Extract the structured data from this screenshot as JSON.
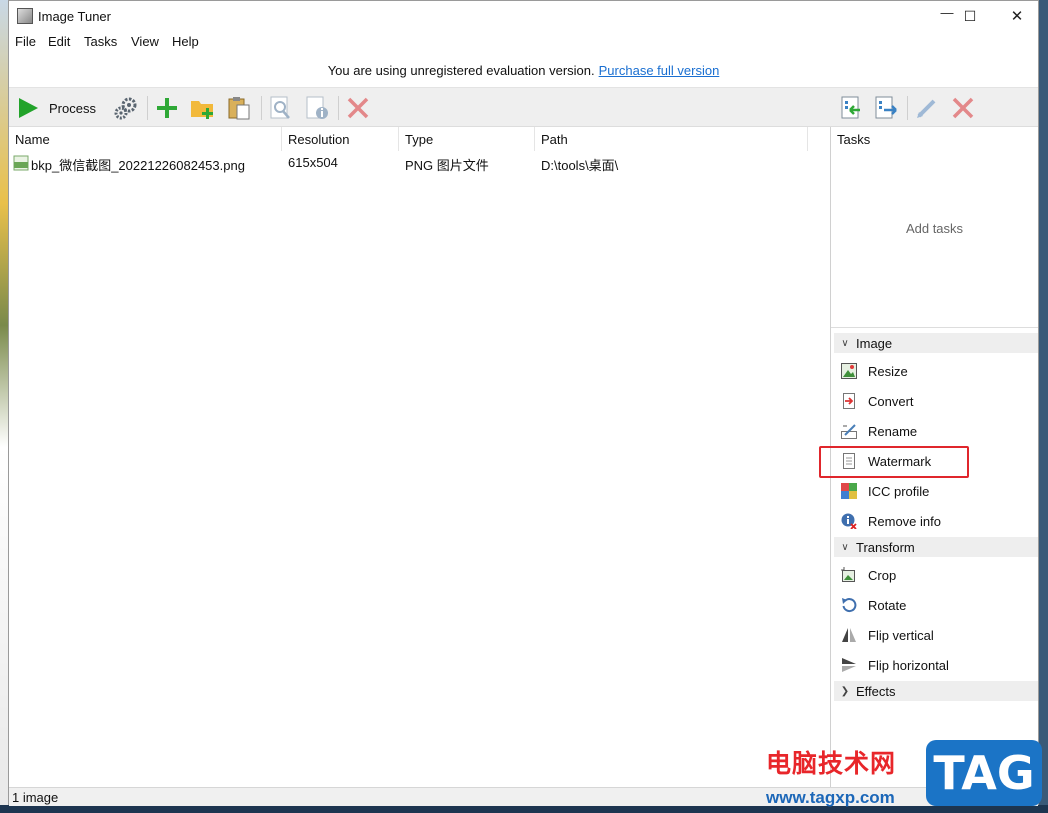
{
  "window": {
    "title": "Image Tuner",
    "controls": {
      "minimize": "—",
      "maximize": "☐",
      "close": "✕"
    }
  },
  "menu": [
    "File",
    "Edit",
    "Tasks",
    "View",
    "Help"
  ],
  "banner": {
    "text": "You are using unregistered evaluation version.",
    "link": "Purchase full version"
  },
  "toolbar": {
    "process_label": "Process"
  },
  "file_list": {
    "columns": [
      "Name",
      "Resolution",
      "Type",
      "Path"
    ],
    "rows": [
      {
        "name": "bkp_微信截图_20221226082453.png",
        "resolution": "615x504",
        "type": "PNG 图片文件",
        "path": "D:\\tools\\桌面\\"
      }
    ]
  },
  "tasks_panel": {
    "header": "Tasks",
    "empty_hint": "Add tasks",
    "groups": [
      {
        "label": "Image",
        "expanded": true,
        "items": [
          "Resize",
          "Convert",
          "Rename",
          "Watermark",
          "ICC profile",
          "Remove info"
        ]
      },
      {
        "label": "Transform",
        "expanded": true,
        "items": [
          "Crop",
          "Rotate",
          "Flip vertical",
          "Flip horizontal"
        ]
      },
      {
        "label": "Effects",
        "expanded": false,
        "items": []
      }
    ],
    "highlighted_item": "Watermark"
  },
  "status": {
    "text": "1 image"
  },
  "colors": {
    "highlight": "#e0262c",
    "link": "#1a6fd1",
    "process_green": "#22a32a"
  },
  "watermark": {
    "cn": "电脑技术网",
    "url": "www.tagxp.com",
    "tag": "TAG"
  }
}
